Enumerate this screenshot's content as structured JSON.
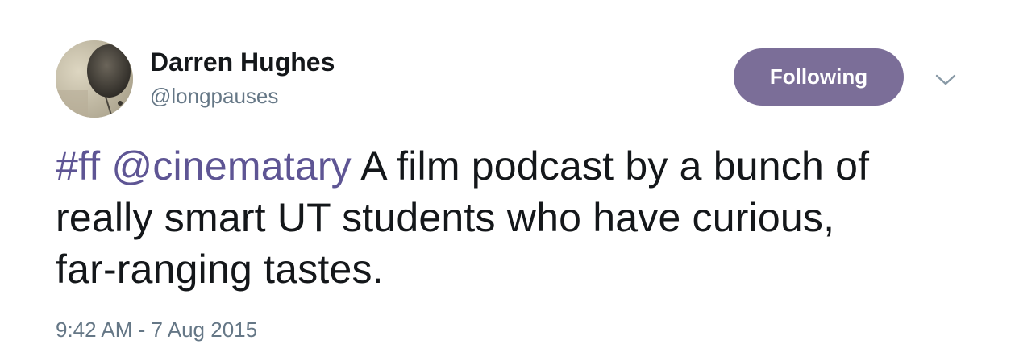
{
  "user": {
    "display_name": "Darren Hughes",
    "handle": "@longpauses"
  },
  "actions": {
    "follow_label": "Following",
    "more_icon": "chevron-down-icon"
  },
  "tweet": {
    "hashtag": "#ff",
    "mention": "@cinematary",
    "line1_rest": " A film podcast by a bunch of",
    "line2": "really smart UT students who have curious,",
    "line3": "far-ranging tastes.",
    "timestamp": "9:42 AM - 7 Aug 2015"
  },
  "colors": {
    "accent": "#7b6e98",
    "link": "#5e5594",
    "text": "#14171a",
    "muted": "#657786"
  }
}
